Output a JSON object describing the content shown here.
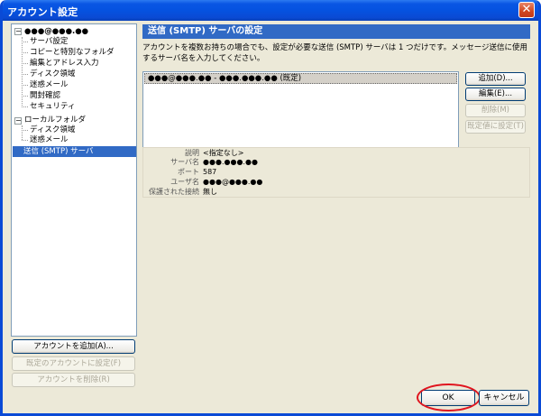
{
  "window": {
    "title": "アカウント設定",
    "close_glyph": "✕"
  },
  "tree": {
    "account_name": "●●●@●●●.●●",
    "account_children": [
      "サーバ設定",
      "コピーと特別なフォルダ",
      "編集とアドレス入力",
      "ディスク領域",
      "迷惑メール",
      "開封確認",
      "セキュリティ"
    ],
    "local_folder": "ローカルフォルダ",
    "local_children": [
      "ディスク領域",
      "迷惑メール"
    ],
    "smtp_item": "送信 (SMTP) サーバ",
    "expander_glyph": "−"
  },
  "left_buttons": {
    "add_account": "アカウントを追加(A)...",
    "set_default": "既定のアカウントに設定(F)",
    "remove_account": "アカウントを削除(R)"
  },
  "panel": {
    "header": "送信 (SMTP) サーバの設定",
    "description": "アカウントを複数お持ちの場合でも、設定が必要な送信 (SMTP) サーバは 1 つだけです。メッセージ送信に使用するサーバ名を入力してください。",
    "server_entry": "●●●@●●●.●● - ●●●.●●●.●● (既定)"
  },
  "right_buttons": {
    "add": "追加(D)...",
    "edit": "編集(E)...",
    "delete": "削除(M)",
    "set_default": "既定値に設定(T)"
  },
  "details": [
    {
      "label": "説明",
      "value": "<指定なし>"
    },
    {
      "label": "サーバ名",
      "value": "●●●.●●●.●●"
    },
    {
      "label": "ポート",
      "value": "587"
    },
    {
      "label": "ユーザ名",
      "value": "●●●@●●●.●●"
    },
    {
      "label": "保護された接続",
      "value": "無し"
    }
  ],
  "dialog_buttons": {
    "ok": "OK",
    "cancel": "キャンセル"
  },
  "colors": {
    "selection": "#316ac5",
    "highlight_circle": "#e0141e",
    "title_bar": "#0552e0"
  }
}
